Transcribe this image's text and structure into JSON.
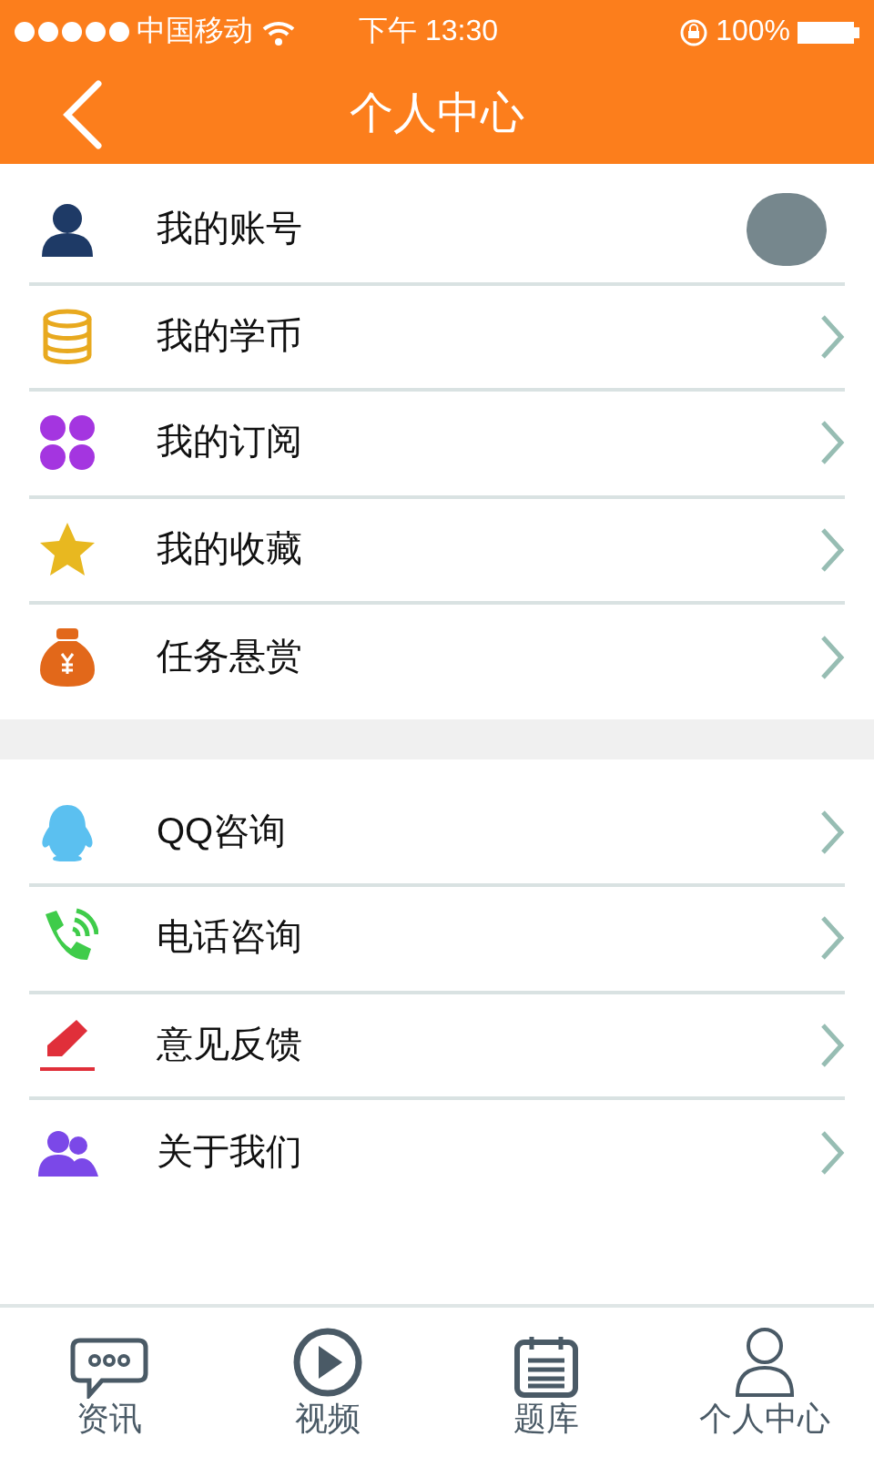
{
  "status_bar": {
    "carrier": "中国移动",
    "time": "下午 13:30",
    "battery": "100%"
  },
  "header": {
    "title": "个人中心"
  },
  "groups": [
    {
      "items": [
        {
          "label": "我的账号",
          "kind": "avatar"
        },
        {
          "label": "我的学币",
          "kind": "arrow"
        },
        {
          "label": "我的订阅",
          "kind": "arrow"
        },
        {
          "label": "我的收藏",
          "kind": "arrow"
        },
        {
          "label": "任务悬赏",
          "kind": "arrow"
        }
      ]
    },
    {
      "items": [
        {
          "label": "QQ咨询",
          "kind": "arrow"
        },
        {
          "label": "电话咨询",
          "kind": "arrow"
        },
        {
          "label": "意见反馈",
          "kind": "arrow"
        },
        {
          "label": "关于我们",
          "kind": "arrow"
        }
      ]
    }
  ],
  "tab_bar": [
    {
      "label": "资讯"
    },
    {
      "label": "视频"
    },
    {
      "label": "题库"
    },
    {
      "label": "个人中心"
    }
  ]
}
